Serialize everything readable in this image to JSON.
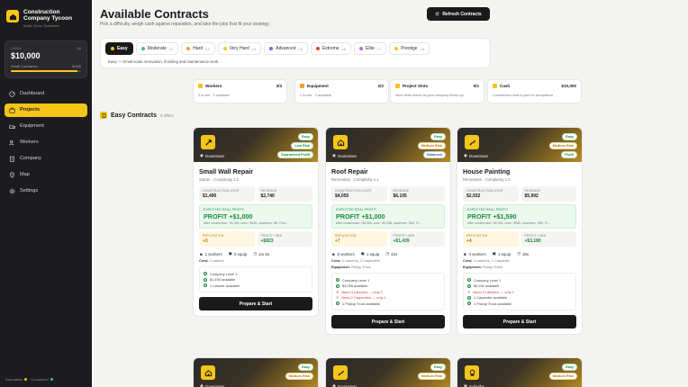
{
  "brand": {
    "title_line1": "Construction",
    "title_line2": "Company Tycoon",
    "tagline": "Build. Grow. Dominate."
  },
  "cash": {
    "label": "CASH",
    "level": "L1",
    "value": "$10,000",
    "rank_label": "Small Contractor",
    "rank_progress": "0/100",
    "rank_fraction": 0.95
  },
  "nav": [
    {
      "label": "Dashboard",
      "icon": "dashboard-icon"
    },
    {
      "label": "Projects",
      "icon": "projects-icon"
    },
    {
      "label": "Equipment",
      "icon": "equipment-icon"
    },
    {
      "label": "Workers",
      "icon": "workers-icon"
    },
    {
      "label": "Company",
      "icon": "company-icon"
    },
    {
      "label": "Map",
      "icon": "map-icon"
    },
    {
      "label": "Settings",
      "icon": "settings-icon"
    }
  ],
  "footer": {
    "reputation": "Reputation",
    "completed": "Completed"
  },
  "header": {
    "title": "Available Contracts",
    "subtitle": "Pick a difficulty, weigh cash against reputation, and take the jobs that fit your strategy.",
    "refresh_label": "Refresh Contracts"
  },
  "difficulty": {
    "tabs": [
      {
        "label": "Easy",
        "lock": "",
        "color": "#f5c518"
      },
      {
        "label": "Moderate",
        "lock": "L2",
        "color": "#3bbf9a"
      },
      {
        "label": "Hard",
        "lock": "L3",
        "color": "#f39c34"
      },
      {
        "label": "Very Hard",
        "lock": "L4",
        "color": "#f5c518"
      },
      {
        "label": "Advanced",
        "lock": "L5",
        "color": "#6d6df0"
      },
      {
        "label": "Extreme",
        "lock": "L6",
        "color": "#e0433f"
      },
      {
        "label": "Elite",
        "lock": "L7",
        "color": "#c06ad8"
      },
      {
        "label": "Prestige",
        "lock": "L8",
        "color": "#f5c518"
      }
    ],
    "description": "Easy — Small-scale renovation, finishing and maintenance work."
  },
  "stats": [
    {
      "label": "Workers",
      "value": "3/3",
      "desc": "3 in use · 3 available",
      "color": "#f5c518"
    },
    {
      "label": "Equipment",
      "value": "2/2",
      "desc": "2 in use · 2 available",
      "color": "#f39c34"
    },
    {
      "label": "Project Slots",
      "value": "0/1",
      "desc": "More slots unlock as your company levels up.",
      "color": "#f5c518"
    },
    {
      "label": "Cash",
      "value": "$10,000",
      "desc": "Construction cost is paid on acceptance.",
      "color": "#f5c518"
    }
  ],
  "section": {
    "title": "Easy Contracts",
    "count": "6 offers"
  },
  "cards": [
    {
      "title": "Small Wall Repair",
      "subtitle": "Starter · Complexity 1.0",
      "location": "Downtown",
      "icon": "hammer-icon",
      "badges": [
        "Easy",
        "Low Risk",
        "Guaranteed Profit"
      ],
      "construction_label": "CONSTRUCTION COST",
      "construction": "$1,490",
      "revenue_label": "REVENUE",
      "revenue": "$2,740",
      "profit_label": "EXPECTED REAL PROFIT",
      "profit": "PROFIT +$1,000",
      "profit_note": "After construction −$1,490, crew −$240, machines −$0. Fina...",
      "rep_label": "REPUTATION",
      "rep": "+3",
      "ppm_label": "PROFIT / MIN",
      "ppm": "+$823",
      "workers": "1 workers",
      "equip": "0 equip",
      "time": "1m 5s",
      "crew": "1 Laborer",
      "equipment": "",
      "checks": [
        {
          "text": "Company Level 1",
          "ok": true
        },
        {
          "text": "$1,490 available",
          "ok": true
        },
        {
          "text": "1 Laborer available",
          "ok": true
        }
      ],
      "button": "Prepare & Start"
    },
    {
      "title": "Roof Repair",
      "subtitle": "Renovation · Complexity 1.1",
      "location": "Downtown",
      "icon": "house-icon",
      "badges": [
        "Easy",
        "Medium Risk",
        "Balanced"
      ],
      "construction_label": "CONSTRUCTION COST",
      "construction": "$4,055",
      "revenue_label": "REVENUE",
      "revenue": "$6,105",
      "profit_label": "EXPECTED REAL PROFIT",
      "profit": "PROFIT +$1,000",
      "profit_note": "After construction −$4,055, crew −$1,038, machines −$42. Fi...",
      "rep_label": "REPUTATION",
      "rep": "+7",
      "ppm_label": "PROFIT / MIN",
      "ppm": "+$1,439",
      "workers": "5 workers",
      "equip": "1 equip",
      "time": "42s",
      "crew": "3 Laborers, 2 Carpenters",
      "equipment": "Pickup Truck",
      "checks": [
        {
          "text": "Company Level 1",
          "ok": true
        },
        {
          "text": "$4,055 available",
          "ok": true
        },
        {
          "text": "Need 3 Laborers — only 2",
          "ok": false
        },
        {
          "text": "Need 2 Carpenters — only 1",
          "ok": false
        },
        {
          "text": "1 Pickup Truck available",
          "ok": true
        }
      ],
      "button": "Prepare & Start"
    },
    {
      "title": "House Painting",
      "subtitle": "Renovation · Complexity 1.0",
      "location": "Downtown",
      "icon": "paint-brush-icon",
      "badges": [
        "Easy",
        "Medium Risk",
        "Profit"
      ],
      "construction_label": "CONSTRUCTION COST",
      "construction": "$2,932",
      "revenue_label": "REVENUE",
      "revenue": "$5,992",
      "profit_label": "EXPECTED REAL PROFIT",
      "profit": "PROFIT +$1,590",
      "profit_note": "After construction −$2,932, crew −$940, machines −$30. Fi...",
      "rep_label": "REPUTATION",
      "rep": "+4",
      "ppm_label": "PROFIT / MIN",
      "ppm": "+$3,180",
      "workers": "4 workers",
      "equip": "1 equip",
      "time": "30s",
      "crew": "3 Laborers, 1 Carpenter",
      "equipment": "Pickup Truck",
      "checks": [
        {
          "text": "Company Level 1",
          "ok": true
        },
        {
          "text": "$2,932 available",
          "ok": true
        },
        {
          "text": "Need 3 Laborers — only 2",
          "ok": false
        },
        {
          "text": "1 Carpenter available",
          "ok": true
        },
        {
          "text": "1 Pickup Truck available",
          "ok": true
        }
      ],
      "button": "Prepare & Start"
    },
    {
      "location": "Downtown",
      "icon": "house-icon",
      "badges": [
        "Easy",
        "Medium Risk"
      ]
    },
    {
      "location": "Downtown",
      "icon": "paint-brush-icon",
      "badges": [
        "Easy",
        "Medium Risk"
      ]
    },
    {
      "location": "Suburbs",
      "icon": "chef-icon",
      "badges": [
        "Easy",
        "Medium Risk"
      ]
    }
  ]
}
